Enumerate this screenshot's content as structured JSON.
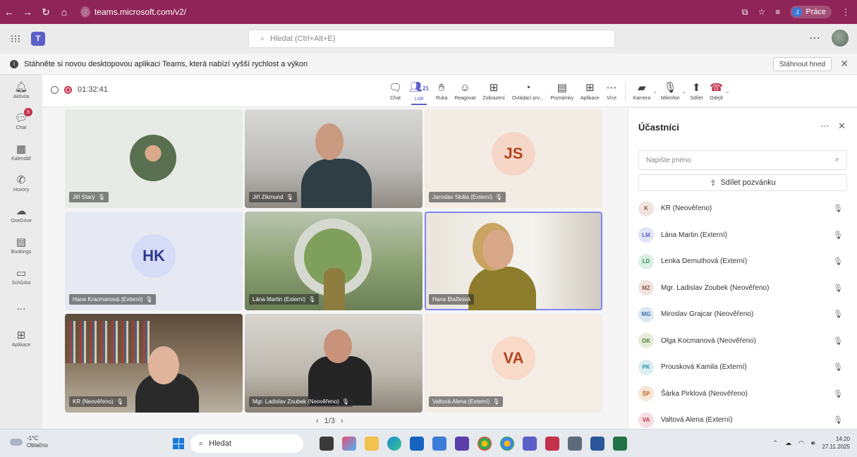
{
  "browser": {
    "url": "teams.microsoft.com/v2/",
    "profile_label": "Práce",
    "profile_initial": "J"
  },
  "teams": {
    "search_placeholder": "Hledat (Ctrl+Alt+E)"
  },
  "banner": {
    "message": "Stáhněte si novou desktopovou aplikaci Teams, která nabízí vyšší rychlost a výkon",
    "button": "Stáhnout hned"
  },
  "rail": {
    "items": [
      {
        "label": "Aktivita",
        "icon": "bell-icon"
      },
      {
        "label": "Chat",
        "icon": "chat-icon",
        "badge": "5"
      },
      {
        "label": "Kalendář",
        "icon": "calendar-icon"
      },
      {
        "label": "Hovory",
        "icon": "phone-icon"
      },
      {
        "label": "OneDrive",
        "icon": "cloud-icon"
      },
      {
        "label": "Bookings",
        "icon": "bookings-icon"
      },
      {
        "label": "Schůzka",
        "icon": "camera-icon"
      },
      {
        "label": "...",
        "icon": "more-icon"
      },
      {
        "label": "Aplikace",
        "icon": "apps-icon"
      }
    ]
  },
  "meeting": {
    "timer": "01:32:41",
    "tools": {
      "chat": "Chat",
      "people": "Lidé",
      "people_count": "21",
      "hand": "Ruka",
      "react": "Reagovat",
      "view": "Zobrazení",
      "controls": "Ovládací prv...",
      "notes": "Poznámky",
      "apps": "Aplikace",
      "more": "Více",
      "camera": "Kamera",
      "mic": "Mikrofon",
      "share": "Sdílet",
      "leave": "Odejít"
    }
  },
  "tiles": [
    {
      "name": "Jiří Starý",
      "initials": "",
      "kind": "photo"
    },
    {
      "name": "Jiří Zikmund",
      "initials": "",
      "kind": "video"
    },
    {
      "name": "Jaroslav Skála (Externí)",
      "initials": "JS",
      "kind": "initials"
    },
    {
      "name": "Hana Kracmanová (Externí)",
      "initials": "HK",
      "kind": "initials"
    },
    {
      "name": "Lána Martin (Externí)",
      "initials": "",
      "kind": "video"
    },
    {
      "name": "Hana Blažková",
      "initials": "",
      "kind": "video"
    },
    {
      "name": "KR (Neověřeno)",
      "initials": "",
      "kind": "video"
    },
    {
      "name": "Mgr. Ladislav Zoubek (Neověřeno)",
      "initials": "",
      "kind": "video"
    },
    {
      "name": "Valtová Alena (Externí)",
      "initials": "VA",
      "kind": "initials"
    }
  ],
  "pager": "1/3",
  "participants": {
    "title": "Účastníci",
    "search_placeholder": "Napište jméno",
    "invite": "Sdílet pozvánku",
    "list": [
      {
        "initials": "K",
        "name": "KR (Neověřeno)",
        "color": "#8a5a44"
      },
      {
        "initials": "LM",
        "name": "Lána Martin (Externí)",
        "color": "#5b5fc7"
      },
      {
        "initials": "LD",
        "name": "Lenka Demuthová (Externí)",
        "color": "#2e8b57"
      },
      {
        "initials": "MZ",
        "name": "Mgr. Ladislav Zoubek (Neověřeno)",
        "color": "#8a5a44"
      },
      {
        "initials": "MG",
        "name": "Miroslav Grajcar (Neověřeno)",
        "color": "#3a6fb0"
      },
      {
        "initials": "OK",
        "name": "Olga Kocmanová (Neověřeno)",
        "color": "#4f7a32"
      },
      {
        "initials": "PK",
        "name": "Prousková Kamila (Externí)",
        "color": "#2f8fa8"
      },
      {
        "initials": "ŠP",
        "name": "Šárka Pirklová (Neověřeno)",
        "color": "#b5651d"
      },
      {
        "initials": "VA",
        "name": "Valtová Alena (Externí)",
        "color": "#c4314b"
      }
    ]
  },
  "taskbar": {
    "temp": "-1°C",
    "weather": "Oblačno",
    "search": "Hledat",
    "time": "14:20",
    "date": "27.11.2025"
  }
}
